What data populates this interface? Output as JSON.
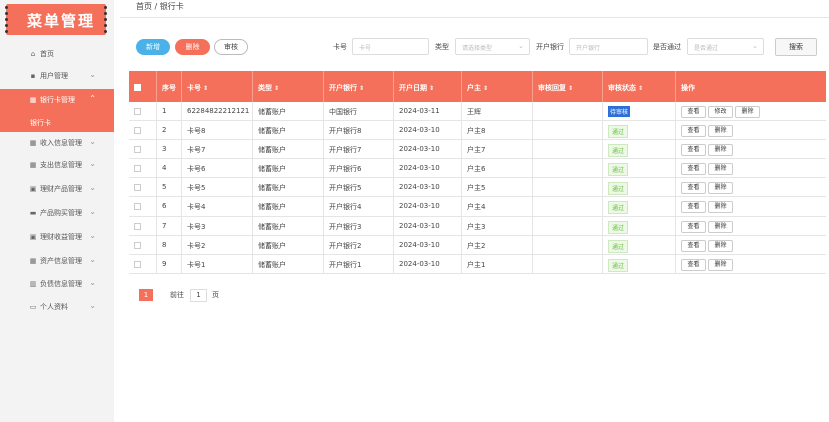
{
  "sidebar": {
    "title": "菜单管理",
    "items": [
      {
        "label": "首页",
        "icon": "home-icon"
      },
      {
        "label": "用户管理",
        "icon": "user-icon"
      },
      {
        "label": "银行卡管理",
        "icon": "grid-icon"
      },
      {
        "label": "收入信息管理",
        "icon": "grid-icon"
      },
      {
        "label": "支出信息管理",
        "icon": "grid-icon"
      },
      {
        "label": "理财产品管理",
        "icon": "bank-icon"
      },
      {
        "label": "产品购买管理",
        "icon": "card-icon"
      },
      {
        "label": "理财收益管理",
        "icon": "bank-icon"
      },
      {
        "label": "资产信息管理",
        "icon": "grid-icon"
      },
      {
        "label": "负债信息管理",
        "icon": "building-icon"
      },
      {
        "label": "个人资料",
        "icon": "calendar-icon"
      }
    ],
    "active_sub": "银行卡"
  },
  "breadcrumb": "首页 / 银行卡",
  "toolbar": {
    "add": "新增",
    "delete": "删除",
    "review": "审核"
  },
  "filters": {
    "card_label": "卡号",
    "card_placeholder": "卡号",
    "type_label": "类型",
    "type_placeholder": "请选择类型",
    "bank_label": "开户银行",
    "bank_placeholder": "开户银行",
    "pass_label": "是否通过",
    "pass_placeholder": "是否通过",
    "search": "搜索"
  },
  "table": {
    "headers": [
      "序号",
      "卡号",
      "类型",
      "开户银行",
      "开户日期",
      "户主",
      "审核回复",
      "审核状态",
      "操作"
    ],
    "rows": [
      {
        "no": "1",
        "card": "62284822212121",
        "type": "储蓄账户",
        "bank": "中国银行",
        "date": "2024-03-11",
        "owner": "王辉",
        "reply": "",
        "status": "待审核",
        "status_kind": "pending",
        "ops": [
          "查看",
          "修改",
          "删除"
        ]
      },
      {
        "no": "2",
        "card": "卡号8",
        "type": "储蓄账户",
        "bank": "开户银行8",
        "date": "2024-03-10",
        "owner": "户主8",
        "reply": "",
        "status": "通过",
        "status_kind": "pass",
        "ops": [
          "查看",
          "删除"
        ]
      },
      {
        "no": "3",
        "card": "卡号7",
        "type": "储蓄账户",
        "bank": "开户银行7",
        "date": "2024-03-10",
        "owner": "户主7",
        "reply": "",
        "status": "通过",
        "status_kind": "pass",
        "ops": [
          "查看",
          "删除"
        ]
      },
      {
        "no": "4",
        "card": "卡号6",
        "type": "储蓄账户",
        "bank": "开户银行6",
        "date": "2024-03-10",
        "owner": "户主6",
        "reply": "",
        "status": "通过",
        "status_kind": "pass",
        "ops": [
          "查看",
          "删除"
        ]
      },
      {
        "no": "5",
        "card": "卡号5",
        "type": "储蓄账户",
        "bank": "开户银行5",
        "date": "2024-03-10",
        "owner": "户主5",
        "reply": "",
        "status": "通过",
        "status_kind": "pass",
        "ops": [
          "查看",
          "删除"
        ]
      },
      {
        "no": "6",
        "card": "卡号4",
        "type": "储蓄账户",
        "bank": "开户银行4",
        "date": "2024-03-10",
        "owner": "户主4",
        "reply": "",
        "status": "通过",
        "status_kind": "pass",
        "ops": [
          "查看",
          "删除"
        ]
      },
      {
        "no": "7",
        "card": "卡号3",
        "type": "储蓄账户",
        "bank": "开户银行3",
        "date": "2024-03-10",
        "owner": "户主3",
        "reply": "",
        "status": "通过",
        "status_kind": "pass",
        "ops": [
          "查看",
          "删除"
        ]
      },
      {
        "no": "8",
        "card": "卡号2",
        "type": "储蓄账户",
        "bank": "开户银行2",
        "date": "2024-03-10",
        "owner": "户主2",
        "reply": "",
        "status": "通过",
        "status_kind": "pass",
        "ops": [
          "查看",
          "删除"
        ]
      },
      {
        "no": "9",
        "card": "卡号1",
        "type": "储蓄账户",
        "bank": "开户银行1",
        "date": "2024-03-10",
        "owner": "户主1",
        "reply": "",
        "status": "通过",
        "status_kind": "pass",
        "ops": [
          "查看",
          "删除"
        ]
      }
    ]
  },
  "pagination": {
    "current": "1",
    "goto_prefix": "前往",
    "goto_value": "1",
    "goto_suffix": "页"
  },
  "colors": {
    "accent": "#f5705a",
    "blue": "#4ab2e9",
    "pass_green": "#6abd45",
    "pending_blue": "#2d6fd6"
  }
}
